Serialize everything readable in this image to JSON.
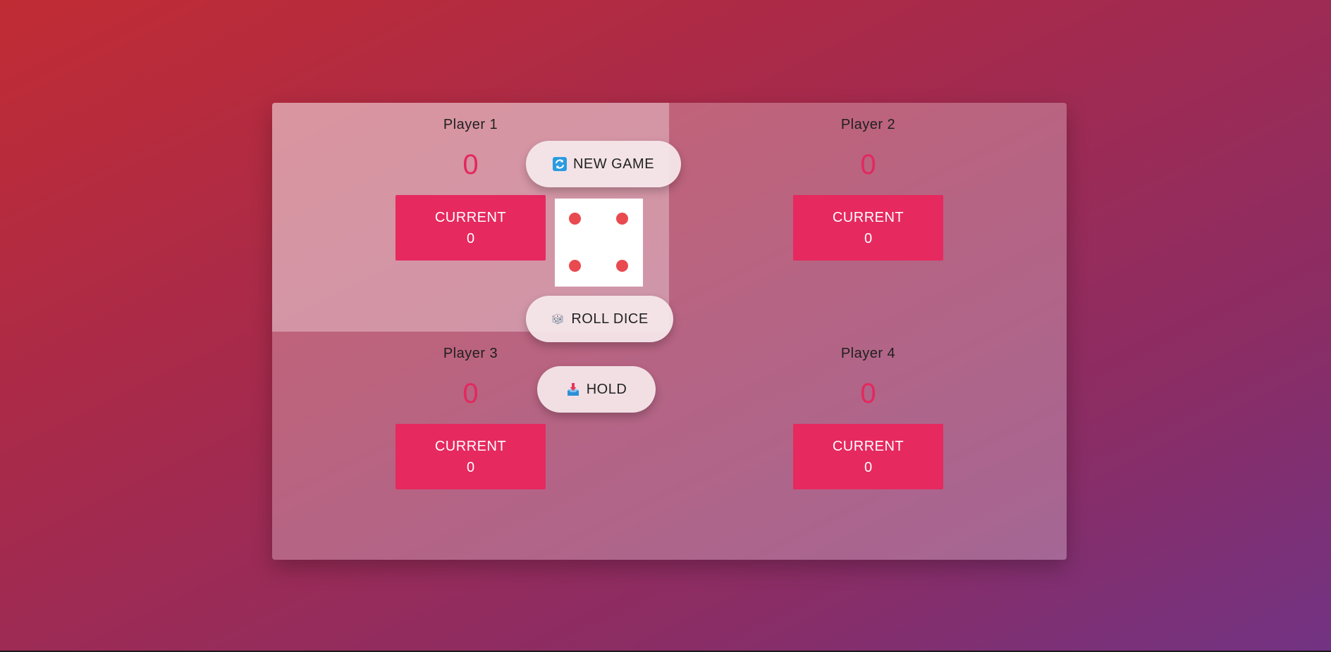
{
  "players": [
    {
      "name": "Player 1",
      "score": "0",
      "current_label": "CURRENT",
      "current_value": "0",
      "active": true
    },
    {
      "name": "Player 2",
      "score": "0",
      "current_label": "CURRENT",
      "current_value": "0",
      "active": false
    },
    {
      "name": "Player 3",
      "score": "0",
      "current_label": "CURRENT",
      "current_value": "0",
      "active": false
    },
    {
      "name": "Player 4",
      "score": "0",
      "current_label": "CURRENT",
      "current_value": "0",
      "active": false
    }
  ],
  "controls": {
    "new_game_label": "NEW GAME",
    "new_game_icon": "refresh-icon",
    "roll_dice_label": "ROLL DICE",
    "roll_dice_icon": "dice-icon",
    "hold_label": "HOLD",
    "hold_icon": "inbox-tray-icon"
  },
  "dice": {
    "value": 4
  },
  "colors": {
    "accent": "#e6295f",
    "score": "#e3285f",
    "pip": "#e84a50"
  }
}
